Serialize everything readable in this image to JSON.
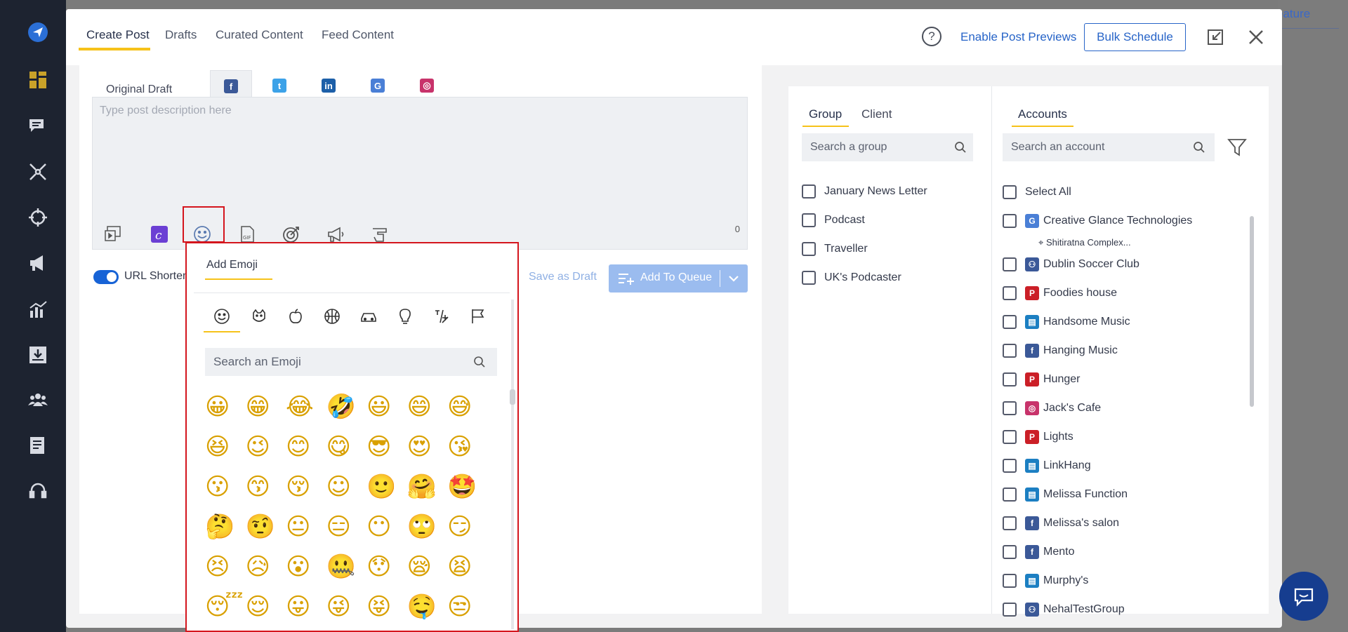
{
  "top_tabs": [
    "Create Post",
    "Drafts",
    "Curated Content",
    "Feed Content"
  ],
  "header": {
    "help": "?",
    "enable_previews": "Enable Post Previews",
    "bulk_schedule": "Bulk Schedule"
  },
  "background": {
    "feature_text": "eature"
  },
  "draft": {
    "original_tab": "Original Draft",
    "network_tabs": [
      "facebook-icon",
      "twitter-icon",
      "linkedin-icon",
      "google-business-icon",
      "instagram-icon"
    ],
    "placeholder": "Type post description here",
    "char_count": "0",
    "tools": [
      "media-icon",
      "canva-icon",
      "emoji-icon",
      "gif-icon",
      "target-icon",
      "megaphone-icon",
      "hand-pointer-icon"
    ]
  },
  "url_shortener": {
    "label": "URL Shorteni",
    "enabled": true
  },
  "actions": {
    "save_draft": "Save as Draft",
    "add_queue": "Add To Queue"
  },
  "emoji_picker": {
    "title": "Add Emoji",
    "categories": [
      "smiley-icon",
      "animal-icon",
      "food-icon",
      "sports-icon",
      "travel-icon",
      "objects-icon",
      "symbols-icon",
      "flags-icon"
    ],
    "search_placeholder": "Search an Emoji",
    "rows": [
      [
        "😀",
        "😁",
        "😂",
        "🤣",
        "😃",
        "😄",
        "😅"
      ],
      [
        "😆",
        "😉",
        "😊",
        "😋",
        "😎",
        "😍",
        "😘"
      ],
      [
        "😗",
        "😙",
        "😚",
        "☺",
        "🙂",
        "🤗",
        "🤩"
      ],
      [
        "🤔",
        "🤨",
        "😐",
        "😑",
        "😶",
        "🙄",
        "😏"
      ],
      [
        "😣",
        "😥",
        "😮",
        "🤐",
        "😯",
        "😪",
        "😫"
      ],
      [
        "😴",
        "😌",
        "😛",
        "😜",
        "😝",
        "🤤",
        "😒"
      ]
    ]
  },
  "groups": {
    "tabs": [
      "Group",
      "Client"
    ],
    "search_placeholder": "Search a group",
    "items": [
      "January News Letter",
      "Podcast",
      "Traveller",
      "UK's Podcaster"
    ]
  },
  "accounts": {
    "tab": "Accounts",
    "search_placeholder": "Search an account",
    "select_all": "Select All",
    "items": [
      {
        "name": "Creative Glance Technologies",
        "icon": "google-business-icon",
        "sub": "Shitiratna Complex..."
      },
      {
        "name": "Dublin Soccer Club",
        "icon": "facebook-group-icon"
      },
      {
        "name": "Foodies house",
        "icon": "pinterest-icon"
      },
      {
        "name": "Handsome Music",
        "icon": "linkedin-page-icon"
      },
      {
        "name": "Hanging Music",
        "icon": "facebook-icon"
      },
      {
        "name": "Hunger",
        "icon": "pinterest-icon"
      },
      {
        "name": "Jack's Cafe",
        "icon": "instagram-icon"
      },
      {
        "name": "Lights",
        "icon": "pinterest-icon"
      },
      {
        "name": "LinkHang",
        "icon": "linkedin-page-icon"
      },
      {
        "name": "Melissa Function",
        "icon": "linkedin-page-icon"
      },
      {
        "name": "Melissa's salon",
        "icon": "facebook-icon"
      },
      {
        "name": "Mento",
        "icon": "facebook-icon"
      },
      {
        "name": "Murphy's",
        "icon": "linkedin-page-icon"
      },
      {
        "name": "NehalTestGroup",
        "icon": "facebook-group-icon"
      }
    ]
  },
  "colors": {
    "accent": "#f6c21a",
    "primary": "#2764c8",
    "highlight": "#d4151d",
    "sidebar": "#1d2330"
  }
}
